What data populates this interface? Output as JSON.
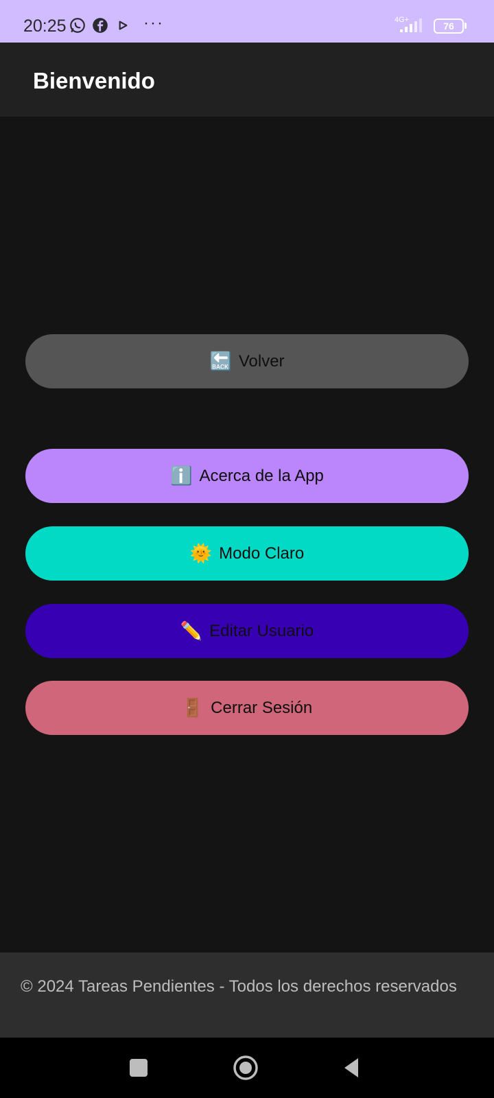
{
  "status_bar": {
    "time": "20:25",
    "network": "4G+",
    "battery": "76",
    "icons": [
      "whatsapp-icon",
      "facebook-icon",
      "play-icon"
    ],
    "more": "···"
  },
  "app_bar": {
    "title": "Bienvenido"
  },
  "buttons": [
    {
      "emoji": "🔙",
      "label": "Volver",
      "color": "#555555"
    },
    {
      "emoji": "ℹ️",
      "label": "Acerca de la App",
      "color": "#bb86fc"
    },
    {
      "emoji": "🌞",
      "label": "Modo Claro",
      "color": "#03dac6"
    },
    {
      "emoji": "✏️",
      "label": "Editar Usuario",
      "color": "#3700b3"
    },
    {
      "emoji": "🚪",
      "label": "Cerrar Sesión",
      "color": "#cf6679"
    }
  ],
  "footer": {
    "text": "© 2024 Tareas Pendientes - Todos los derechos reservados"
  },
  "nav_bar": {
    "icons": [
      "recents-icon",
      "home-icon",
      "back-icon"
    ]
  }
}
